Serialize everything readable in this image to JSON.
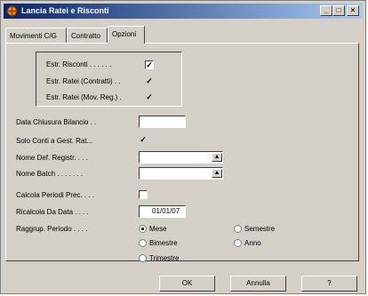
{
  "window": {
    "title": "Lancia Ratei e Risconti",
    "controls": {
      "minimize": "_",
      "maximize": "□",
      "close": "×"
    }
  },
  "tabs": [
    "Movimenti C/G",
    "Contratto",
    "Opzioni"
  ],
  "active_tab": "Opzioni",
  "group": {
    "items": [
      {
        "label": "Estr. Risconti . . . . . .",
        "checked": "✓"
      },
      {
        "label": "Estr. Ratei (Contratti) . .",
        "checked": "✓"
      },
      {
        "label": "Estr. Ratei (Mov. Reg.) .",
        "checked": "✓"
      }
    ]
  },
  "form": {
    "data_chiusura": {
      "label": "Data Chiusura Bilancio . .",
      "value": ""
    },
    "solo_conti": {
      "label": "Solo Conti a Gest. Rat...",
      "checked": "✓"
    },
    "nome_def": {
      "label": "Nome Def. Registr. . . .",
      "value": ""
    },
    "nome_batch": {
      "label": "Nome Batch . . . . . . .",
      "value": ""
    },
    "calcola_periodi": {
      "label": "Calcola Periodi Prec. . . .",
      "checked": ""
    },
    "ricalcola": {
      "label": "Ricalcola Da Data . . . .",
      "value": "01/01/07"
    },
    "raggrup": {
      "label": "Raggrup. Periodo . . . .",
      "options": [
        "Mese",
        "Semestre",
        "Bimestre",
        "Anno",
        "Trimestre"
      ],
      "selected": "Mese"
    }
  },
  "buttons": {
    "ok": "OK",
    "annulla": "Annulla",
    "help": "?"
  },
  "icons": {
    "dropdown": "dropdown-arrow-icon",
    "app": "app-icon"
  }
}
